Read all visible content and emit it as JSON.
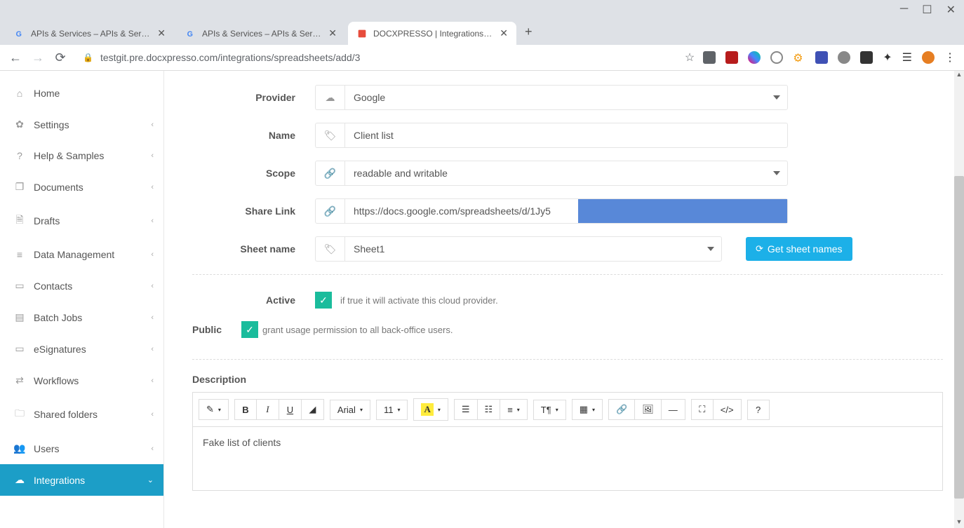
{
  "browser": {
    "tabs": [
      {
        "title": "APIs & Services – APIs & Services",
        "favicon": "G"
      },
      {
        "title": "APIs & Services – APIs & Services",
        "favicon": "G"
      },
      {
        "title": "DOCXPRESSO | Integrations - Sp",
        "favicon": "D"
      }
    ],
    "url": "testgit.pre.docxpresso.com/integrations/spreadsheets/add/3"
  },
  "sidebar": {
    "items": [
      {
        "label": "Home",
        "icon": "home",
        "expandable": false
      },
      {
        "label": "Settings",
        "icon": "gear",
        "expandable": true
      },
      {
        "label": "Help & Samples",
        "icon": "help",
        "expandable": true
      },
      {
        "label": "Documents",
        "icon": "copy",
        "expandable": true
      },
      {
        "label": "Drafts",
        "icon": "file",
        "expandable": true
      },
      {
        "label": "Data Management",
        "icon": "database",
        "expandable": true
      },
      {
        "label": "Contacts",
        "icon": "card",
        "expandable": true
      },
      {
        "label": "Batch Jobs",
        "icon": "batch",
        "expandable": true
      },
      {
        "label": "eSignatures",
        "icon": "signature",
        "expandable": true
      },
      {
        "label": "Workflows",
        "icon": "workflow",
        "expandable": true
      },
      {
        "label": "Shared folders",
        "icon": "folder",
        "expandable": true
      },
      {
        "label": "Users",
        "icon": "users",
        "expandable": true
      },
      {
        "label": "Integrations",
        "icon": "cloud",
        "expandable": true,
        "active": true
      }
    ]
  },
  "form": {
    "provider": {
      "label": "Provider",
      "value": "Google"
    },
    "name": {
      "label": "Name",
      "value": "Client list"
    },
    "scope": {
      "label": "Scope",
      "value": "readable and writable"
    },
    "share": {
      "label": "Share Link",
      "value": "https://docs.google.com/spreadsheets/d/1Jy5"
    },
    "sheet": {
      "label": "Sheet name",
      "value": "Sheet1"
    },
    "get_sheets_btn": "Get sheet names",
    "active": {
      "label": "Active",
      "help": "if true it will activate this cloud provider."
    },
    "public": {
      "label": "Public",
      "help": "grant usage permission to all back-office users."
    }
  },
  "editor": {
    "title": "Description",
    "font_family": "Arial",
    "font_size": "11",
    "content": "Fake list of clients",
    "help_btn": "?"
  }
}
